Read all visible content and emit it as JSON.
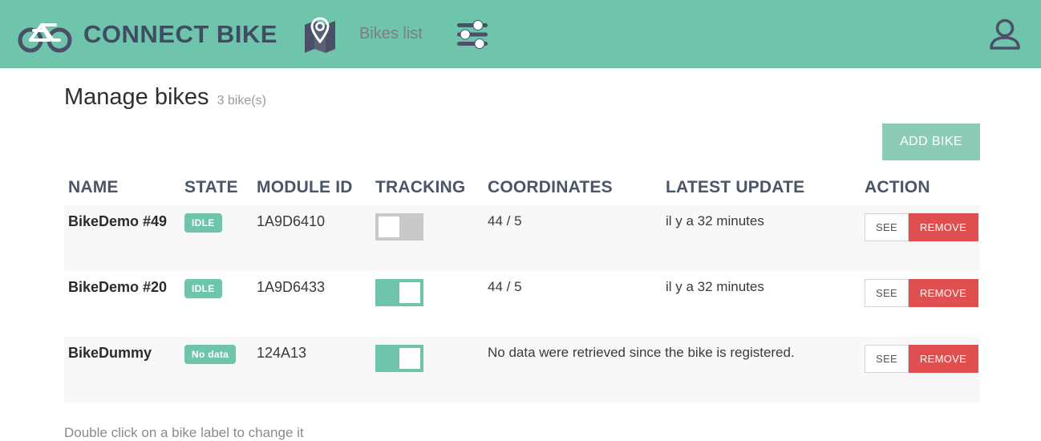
{
  "navbar": {
    "brand_name": "CONNECT BIKE",
    "brand_logo_icon": "bicycle-icon",
    "map_icon": "map-pin-icon",
    "bikes_list_label": "Bikes list",
    "settings_icon": "sliders-settings-icon",
    "user_icon": "user-account-icon",
    "background_color": "#6fc4ac",
    "brand_text_color": "#3f4d63"
  },
  "page": {
    "title": "Manage bikes",
    "subtitle": "3 bike(s)",
    "add_bike_label": "ADD BIKE",
    "hint": "Double click on a bike label to change it"
  },
  "table": {
    "headers": [
      "NAME",
      "STATE",
      "MODULE ID",
      "TRACKING",
      "COORDINATES",
      "LATEST UPDATE",
      "ACTION"
    ],
    "see_label": "SEE",
    "remove_label": "REMOVE",
    "rows": [
      {
        "name": "BikeDemo #49",
        "state": "IDLE",
        "module_id": "1A9D6410",
        "tracking": false,
        "coordinates": "44 / 5",
        "latest_update": "il y a 32 minutes",
        "no_data_message": ""
      },
      {
        "name": "BikeDemo #20",
        "state": "IDLE",
        "module_id": "1A9D6433",
        "tracking": true,
        "coordinates": "44 / 5",
        "latest_update": "il y a 32 minutes",
        "no_data_message": ""
      },
      {
        "name": "BikeDummy",
        "state": "No data",
        "module_id": "124A13",
        "tracking": true,
        "coordinates": "",
        "latest_update": "",
        "no_data_message": "No data were retrieved since the bike is registered."
      }
    ]
  },
  "colors": {
    "accent_green": "#6fc4ac",
    "button_green": "#8ccbb8",
    "danger_red": "#e04f4f",
    "toggle_off_gray": "#c9c9c9",
    "header_text": "#4a5568"
  }
}
